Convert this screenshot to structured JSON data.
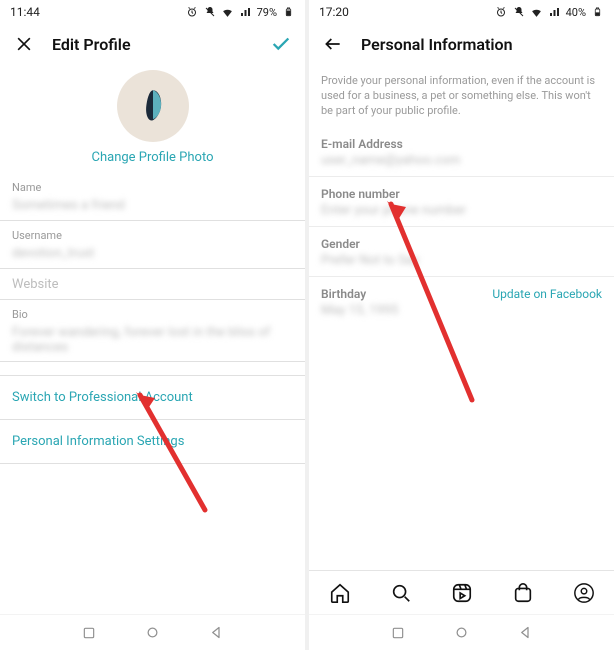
{
  "left": {
    "statusbar": {
      "time": "11:44",
      "battery": "79%"
    },
    "title": "Edit Profile",
    "change_photo": "Change Profile Photo",
    "fields": {
      "name_label": "Name",
      "name_value": "Sometimes a friend",
      "username_label": "Username",
      "username_value": "devotion_trust",
      "website_label": "Website",
      "website_value": "",
      "bio_label": "Bio",
      "bio_value": "Forever wandering, forever lost in the bliss of distances"
    },
    "switch_pro": "Switch to Professional Account",
    "personal_info": "Personal Information Settings"
  },
  "right": {
    "statusbar": {
      "time": "17:20",
      "battery": "40%"
    },
    "title": "Personal Information",
    "description": "Provide your personal information, even if the account is used for a business, a pet or something else. This won't be part of your public profile.",
    "email_label": "E-mail Address",
    "email_value": "user_name@yahoo.com",
    "phone_label": "Phone number",
    "phone_value": "Enter your phone number",
    "gender_label": "Gender",
    "gender_value": "Prefer Not to Say",
    "birthday_label": "Birthday",
    "birthday_value": "May 15, 1995",
    "update_fb": "Update on Facebook"
  }
}
